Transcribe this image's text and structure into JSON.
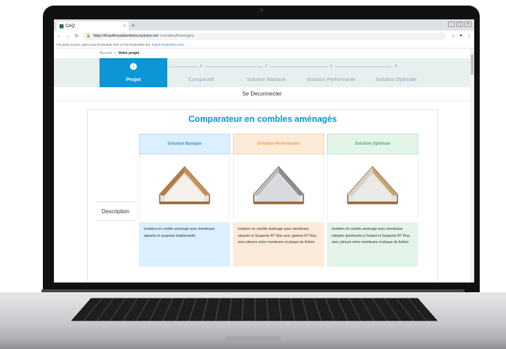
{
  "browser": {
    "tab_title": "CAQ",
    "tab_close": "×",
    "new_tab": "+",
    "url_host": "https://knaufinsulationbeta.mytravo.net",
    "url_path": "/comblesAmenages",
    "bookmarks_text": "For quick access, place your bookmarks here on the bookmarks bar.",
    "bookmarks_link": "Import bookmarks now..."
  },
  "breadcrumb": {
    "home": "Accueil",
    "separator": ">",
    "current": "Votre projet"
  },
  "steps": [
    {
      "num": "1",
      "label": "Projet"
    },
    {
      "num": "2",
      "label": "Comparatif"
    },
    {
      "num": "3",
      "label": "Solution Basique"
    },
    {
      "num": "4",
      "label": "Solution Performante"
    },
    {
      "num": "5",
      "label": "Solution Optimale"
    }
  ],
  "logout_label": "Se Deconnecter",
  "comparator": {
    "title": "Comparateur en combles aménagés",
    "row_label": "Description",
    "columns": [
      {
        "title": "Solution Basique",
        "description": "Isolation en comble aménagé avec membrane séparée et suspente traditionnelle"
      },
      {
        "title": "Solution Performante",
        "description": "Isolation en comble aménagé avec membrane séparée et Suspente RT Max avec gamme RT Max, avec plenum entre membrane et plaque de finition"
      },
      {
        "title": "Solution Optimale",
        "description": "Isolation en comble aménagé avec membrane intégrée aluminisée à l'isolant et Suspente RT Plus, avec plenum entre membrane et plaque de finition"
      }
    ]
  },
  "icons": {
    "back": "back-arrow-icon",
    "forward": "forward-arrow-icon",
    "reload": "reload-icon",
    "lock": "lock-icon",
    "star": "star-icon",
    "profile": "profile-icon",
    "menu": "menu-icon"
  },
  "colors": {
    "accent": "#0b96d6",
    "basic": "#2a9ad3",
    "performante": "#f0a040",
    "optimale": "#4caf78"
  }
}
